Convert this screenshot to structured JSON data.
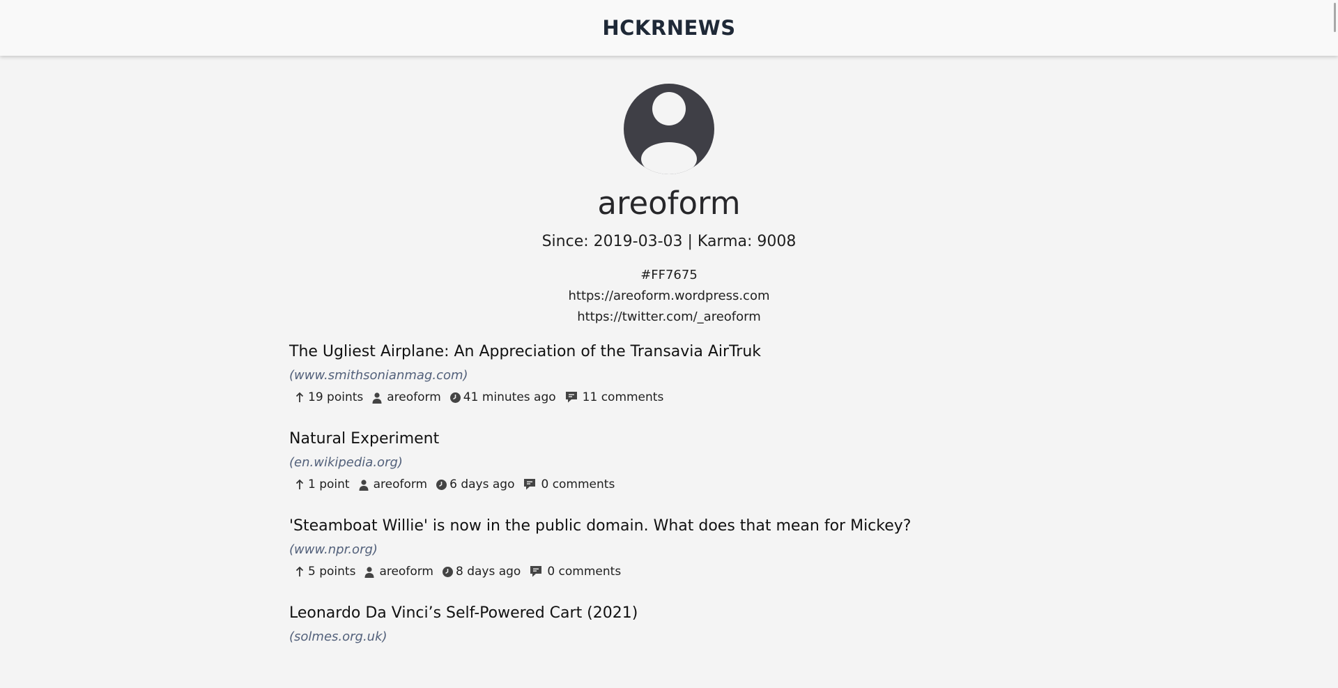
{
  "header": {
    "brand": "HCKRNEWS"
  },
  "profile": {
    "username": "areoform",
    "since_line": "Since: 2019-03-03 | Karma: 9008",
    "about": [
      "#FF7675",
      "https://areoform.wordpress.com",
      "https://twitter.com/_areoform"
    ],
    "avatar_icon": "user-circle-icon"
  },
  "stories": [
    {
      "title": "The Ugliest Airplane: An Appreciation of the Transavia AirTruk",
      "domain": "(www.smithsonianmag.com)",
      "points": "19 points",
      "author": "areoform",
      "time": "41 minutes ago",
      "comments": "11 comments"
    },
    {
      "title": "Natural Experiment",
      "domain": "(en.wikipedia.org)",
      "points": "1 point",
      "author": "areoform",
      "time": "6 days ago",
      "comments": "0 comments"
    },
    {
      "title": "'Steamboat Willie' is now in the public domain. What does that mean for Mickey?",
      "domain": "(www.npr.org)",
      "points": "5 points",
      "author": "areoform",
      "time": "8 days ago",
      "comments": "0 comments"
    },
    {
      "title": "Leonardo Da Vinci’s Self-Powered Cart (2021)",
      "domain": "(solmes.org.uk)",
      "points": "",
      "author": "",
      "time": "",
      "comments": ""
    }
  ],
  "icons": {
    "points": "arrow-up-icon",
    "author": "user-icon",
    "time": "clock-icon",
    "comments": "comment-icon"
  },
  "colors": {
    "background": "#f4f4f4",
    "header_bg": "#f9f9f9",
    "avatar": "#3f3f46",
    "domain": "#52607a"
  }
}
